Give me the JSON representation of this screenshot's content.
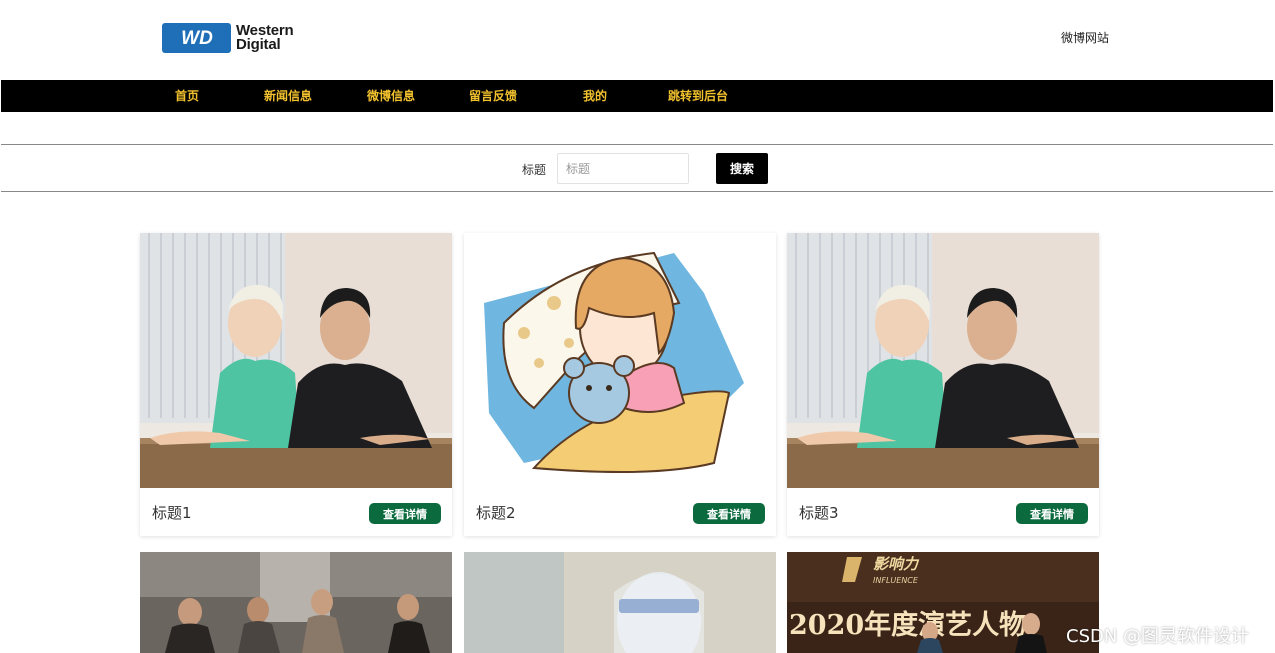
{
  "header": {
    "logo_line1": "Western",
    "logo_line2": "Digital",
    "logo_badge": "WD",
    "site_link": "微博网站"
  },
  "nav": {
    "items": [
      "首页",
      "新闻信息",
      "微博信息",
      "留言反馈",
      "我的",
      "跳转到后台"
    ]
  },
  "search": {
    "label": "标题",
    "placeholder": "标题",
    "value": "",
    "button": "搜索"
  },
  "cards": [
    {
      "title": "标题1",
      "button": "查看详情",
      "image": "photo-couple-at-table"
    },
    {
      "title": "标题2",
      "button": "查看详情",
      "image": "illustration-sleeping-girl-with-bear"
    },
    {
      "title": "标题3",
      "button": "查看详情",
      "image": "photo-couple-at-table"
    }
  ],
  "cards_row2": [
    {
      "image": "photo-street-group"
    },
    {
      "image": "photo-face-shield"
    },
    {
      "image": "photo-award-stage",
      "image_text": "2020年度演艺人物",
      "image_logo": "影响力",
      "image_logo_sub": "INFLUENCE"
    }
  ],
  "watermark": "CSDN @图灵软件设计",
  "colors": {
    "nav_bg": "#000000",
    "nav_text": "#f2c12e",
    "detail_button": "#0b6b3f",
    "wd_blue": "#1e6fb8"
  }
}
